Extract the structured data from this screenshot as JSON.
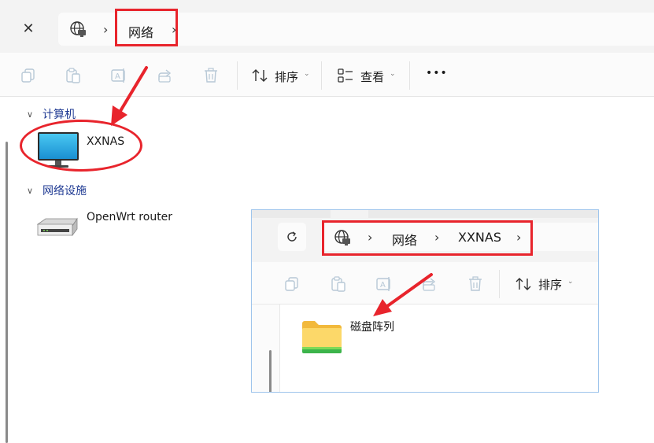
{
  "main": {
    "breadcrumb": [
      "网络"
    ],
    "toolbar": {
      "sort_label": "排序",
      "view_label": "查看",
      "more_label": "•••"
    },
    "groups": [
      {
        "title": "计算机",
        "items": [
          {
            "label": "XXNAS"
          }
        ]
      },
      {
        "title": "网络设施",
        "items": [
          {
            "label": "OpenWrt router"
          }
        ]
      }
    ]
  },
  "inset": {
    "breadcrumb": [
      "网络",
      "XXNAS"
    ],
    "toolbar": {
      "sort_label": "排序"
    },
    "items": [
      {
        "label": "磁盘阵列"
      }
    ]
  },
  "colors": {
    "highlight": "#e8242c",
    "group_header": "#1f3a93",
    "inset_border": "#9fc5ec"
  },
  "icons": [
    "close-icon",
    "globe-icon",
    "copy-icon",
    "paste-icon",
    "rename-icon",
    "share-icon",
    "delete-icon",
    "sort-icon",
    "view-icon",
    "more-icon",
    "refresh-icon",
    "computer-icon",
    "router-icon",
    "folder-icon"
  ]
}
